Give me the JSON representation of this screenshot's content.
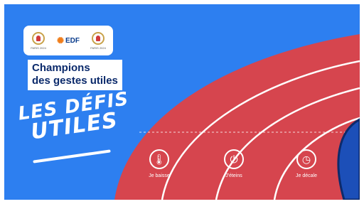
{
  "logos": {
    "left_caption": "PARIS 2024",
    "right_caption": "PARIS 2024",
    "sponsor": "EDF",
    "left_icon": "paris-2024-paralympic-emblem",
    "right_icon": "paris-2024-olympic-emblem"
  },
  "title": {
    "line1": "Champions",
    "line2": "des gestes utiles"
  },
  "slogan": {
    "line1": "LES DÉFIS",
    "line2": "UTILES"
  },
  "gestures": [
    {
      "label": "Je baisse",
      "icon": "thermometer-icon"
    },
    {
      "label": "J'éteins",
      "icon": "light-off-icon"
    },
    {
      "label": "Je décale",
      "icon": "clock-icon"
    }
  ],
  "colors": {
    "background": "#2d7ff0",
    "track": "#d6454e",
    "lane_lines": "#ffffff",
    "title_text": "#0b2a6b",
    "infield": "#1c4fb8"
  }
}
